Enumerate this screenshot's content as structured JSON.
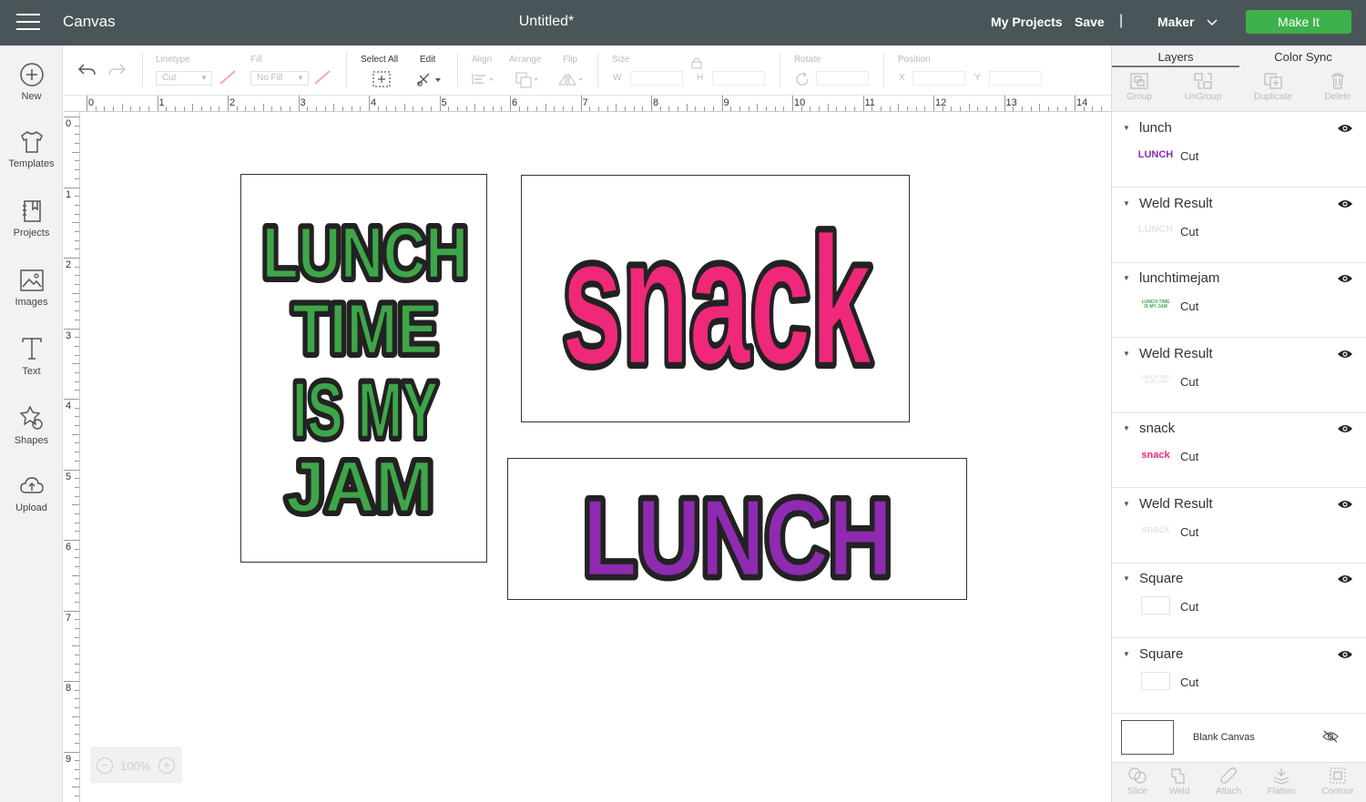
{
  "app": {
    "title": "Canvas",
    "document_title": "Untitled*",
    "my_projects": "My Projects",
    "save": "Save",
    "separator": "|",
    "machine": "Maker",
    "make_it": "Make It"
  },
  "sidebar": {
    "items": [
      {
        "label": "New",
        "icon": "plus-circle-icon"
      },
      {
        "label": "Templates",
        "icon": "tshirt-icon"
      },
      {
        "label": "Projects",
        "icon": "projects-icon"
      },
      {
        "label": "Images",
        "icon": "image-icon"
      },
      {
        "label": "Text",
        "icon": "text-icon"
      },
      {
        "label": "Shapes",
        "icon": "shapes-icon"
      },
      {
        "label": "Upload",
        "icon": "upload-icon"
      }
    ]
  },
  "toolbar": {
    "linetype_label": "Linetype",
    "linetype_value": "Cut",
    "fill_label": "Fill",
    "fill_value": "No Fill",
    "select_all": "Select All",
    "edit": "Edit",
    "align": "Align",
    "arrange": "Arrange",
    "flip": "Flip",
    "size": "Size",
    "size_w": "W",
    "size_h": "H",
    "rotate": "Rotate",
    "position": "Position",
    "pos_x": "X",
    "pos_y": "Y"
  },
  "ruler": {
    "h_numbers": [
      "0",
      "1",
      "2",
      "3",
      "4",
      "5",
      "6",
      "7",
      "8",
      "9",
      "10",
      "11",
      "12",
      "13",
      "14"
    ],
    "v_numbers": [
      "0",
      "1",
      "2",
      "3",
      "4",
      "5",
      "6",
      "7",
      "8",
      "9"
    ]
  },
  "canvas": {
    "design_lunchtime": [
      "LUNCH",
      "TIME",
      "IS MY",
      "JAM"
    ],
    "design_snack": "snack",
    "design_lunch": "LUNCH",
    "zoom_minus": "−",
    "zoom_plus": "+",
    "zoom": "100%",
    "colors": {
      "green": "#3ea649",
      "pink": "#f0287a",
      "purple": "#8e2bb0"
    }
  },
  "panel": {
    "tabs": [
      "Layers",
      "Color Sync"
    ],
    "actions": [
      "Group",
      "UnGroup",
      "Duplicate",
      "Delete"
    ],
    "layers": [
      {
        "name": "lunch",
        "op": "Cut",
        "thumb": "LUNCH",
        "color": "#8e2bb0"
      },
      {
        "name": "Weld Result",
        "op": "Cut",
        "thumb": "LUNCH",
        "color": "#e6e6e6"
      },
      {
        "name": "lunchtimejam",
        "op": "Cut",
        "thumb": "LUNCH TIME IS MY JAM",
        "color": "#3ea649"
      },
      {
        "name": "Weld Result",
        "op": "Cut",
        "thumb": "LUNCH TIME IS MY JAM",
        "color": "#e6e6e6"
      },
      {
        "name": "snack",
        "op": "Cut",
        "thumb": "snack",
        "color": "#f0287a"
      },
      {
        "name": "Weld Result",
        "op": "Cut",
        "thumb": "snack",
        "color": "#e6e6e6"
      },
      {
        "name": "Square",
        "op": "Cut",
        "thumb": "",
        "color": "#ffffff"
      },
      {
        "name": "Square",
        "op": "Cut",
        "thumb": "",
        "color": "#ffffff"
      }
    ],
    "blank_canvas": "Blank Canvas",
    "bottom_actions": [
      "Slice",
      "Weld",
      "Attach",
      "Flatten",
      "Contour"
    ]
  }
}
